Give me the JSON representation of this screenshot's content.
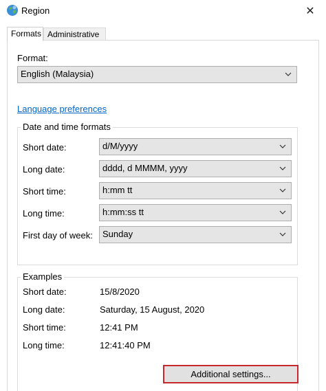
{
  "window": {
    "title": "Region",
    "app_icon": "globe-icon",
    "close_icon": "✕"
  },
  "tabs": [
    {
      "label": "Formats",
      "active": true
    },
    {
      "label": "Administrative",
      "active": false
    }
  ],
  "format": {
    "label": "Format:",
    "value": "English (Malaysia)"
  },
  "language_link": "Language preferences",
  "date_time_formats": {
    "title": "Date and time formats",
    "rows": [
      {
        "label": "Short date:",
        "value": "d/M/yyyy"
      },
      {
        "label": "Long date:",
        "value": "dddd, d MMMM, yyyy"
      },
      {
        "label": "Short time:",
        "value": "h:mm tt"
      },
      {
        "label": "Long time:",
        "value": "h:mm:ss tt"
      },
      {
        "label": "First day of week:",
        "value": "Sunday"
      }
    ]
  },
  "examples": {
    "title": "Examples",
    "rows": [
      {
        "label": "Short date:",
        "value": "15/8/2020"
      },
      {
        "label": "Long date:",
        "value": "Saturday, 15 August, 2020"
      },
      {
        "label": "Short time:",
        "value": "12:41 PM"
      },
      {
        "label": "Long time:",
        "value": "12:41:40 PM"
      }
    ]
  },
  "additional_button": "Additional settings...",
  "colors": {
    "link": "#0066cc",
    "highlight_border": "#c8272d",
    "combo_bg": "#e5e5e5"
  }
}
